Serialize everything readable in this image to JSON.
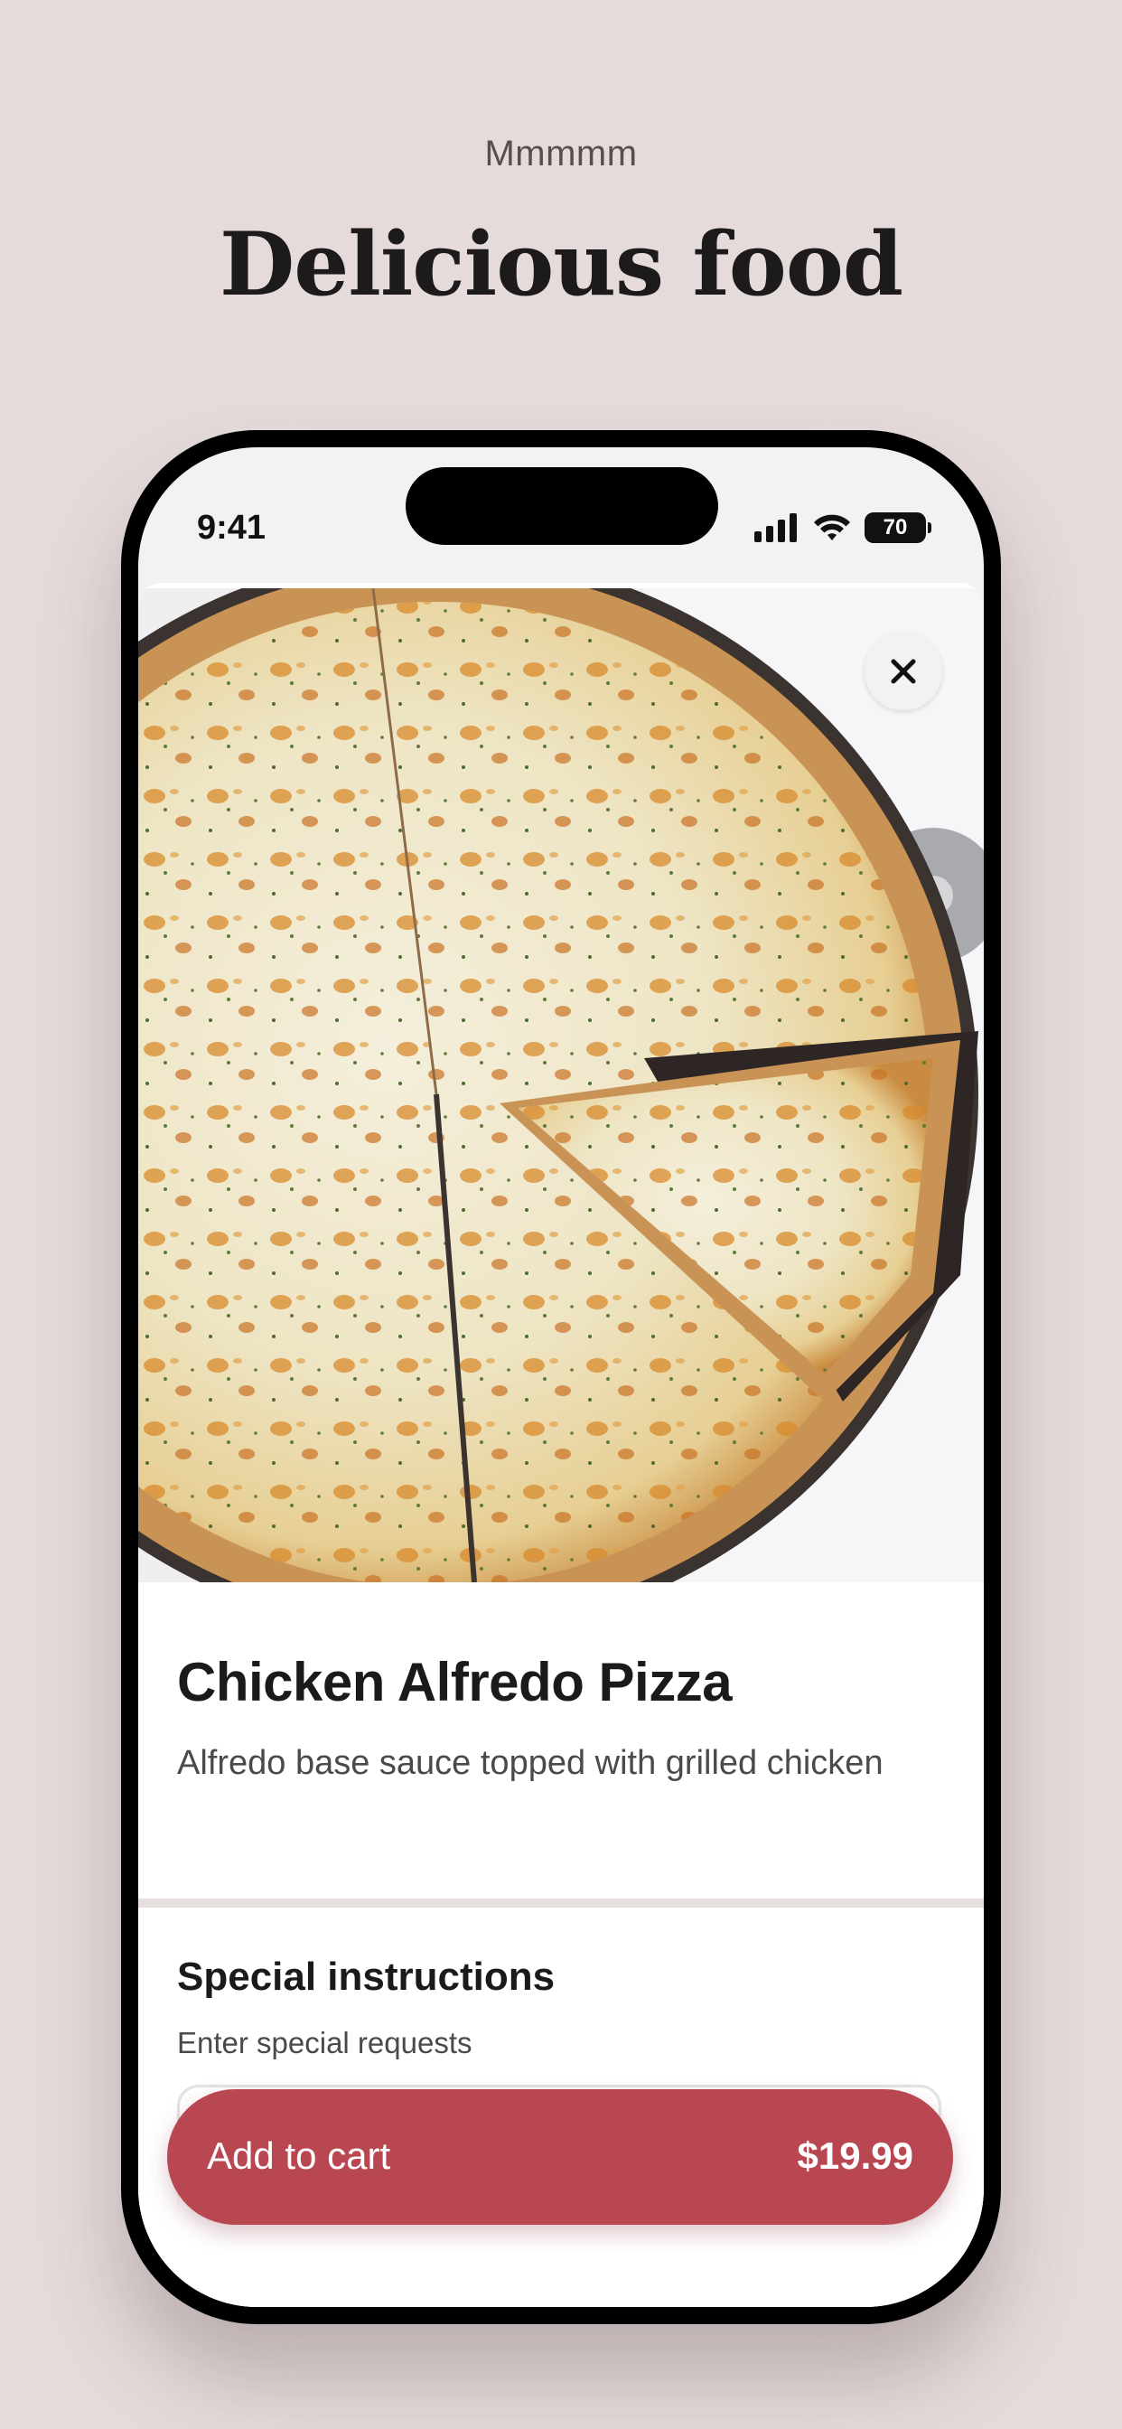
{
  "header": {
    "eyebrow": "Mmmmm",
    "headline": "Delicious food"
  },
  "status_bar": {
    "time": "9:41",
    "battery": "70",
    "icons": [
      "cellular-signal-icon",
      "wifi-icon",
      "battery-icon"
    ]
  },
  "item": {
    "image": "chicken-alfredo-pizza-photo",
    "title": "Chicken Alfredo Pizza",
    "description": "Alfredo base sauce topped with grilled chicken"
  },
  "special_instructions": {
    "title": "Special instructions",
    "subtitle": "Enter special requests",
    "value": "",
    "placeholder": ""
  },
  "cart": {
    "label": "Add to cart",
    "price": "$19.99"
  },
  "colors": {
    "background": "#e5dbdb",
    "accent": "#b94751",
    "text": "#1a1a1a"
  }
}
